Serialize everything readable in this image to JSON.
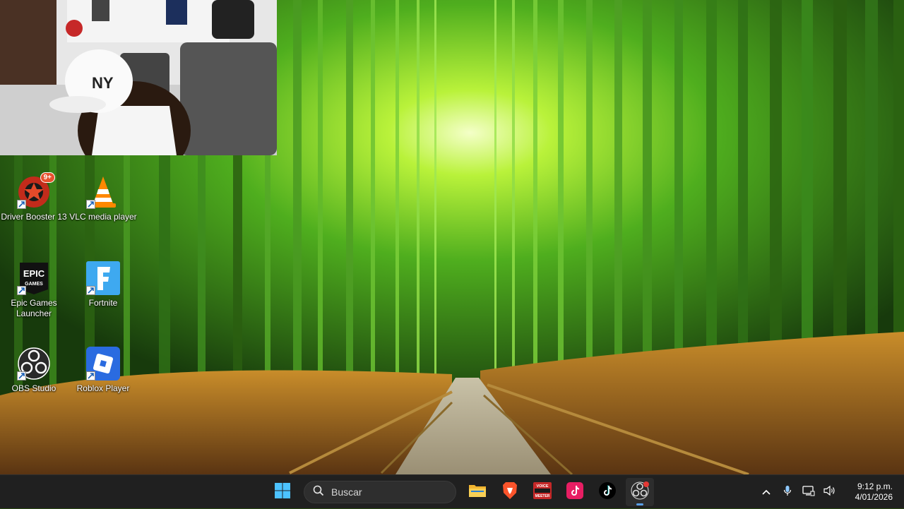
{
  "desktop": {
    "icons": [
      {
        "label": "Driver Booster 13",
        "icon": "driver-booster-icon",
        "badge": "9+"
      },
      {
        "label": "VLC media player",
        "icon": "vlc-icon"
      },
      {
        "label": "Epic Games Launcher",
        "icon": "epic-games-icon",
        "logo_text": "EPIC GAMES"
      },
      {
        "label": "Fortnite",
        "icon": "fortnite-icon",
        "logo_text": "F"
      },
      {
        "label": "OBS Studio",
        "icon": "obs-icon"
      },
      {
        "label": "Roblox Player",
        "icon": "roblox-icon"
      }
    ]
  },
  "webcam": {
    "cap_text": "NY"
  },
  "taskbar": {
    "start_icon": "windows-start-icon",
    "search": {
      "placeholder": "Buscar",
      "value": ""
    },
    "apps": [
      {
        "name": "File Explorer",
        "icon": "folder-icon"
      },
      {
        "name": "Brave",
        "icon": "brave-icon"
      },
      {
        "name": "Voicemeeter",
        "icon": "voicemeeter-icon",
        "logo_text": "VOICE MEETER"
      },
      {
        "name": "TikTok",
        "icon": "tiktok-icon"
      },
      {
        "name": "TikTok",
        "icon": "tiktok-icon"
      },
      {
        "name": "OBS Studio",
        "icon": "obs-icon",
        "active": true
      }
    ],
    "tray": {
      "icons": [
        "chevron-up-icon",
        "microphone-icon",
        "network-icon",
        "speaker-icon"
      ],
      "time": "9:12 p.m.",
      "date": "4/01/2026"
    }
  },
  "colors": {
    "taskbar_bg": "#202020",
    "accent": "#5aa0e8",
    "bamboo": "#4fae1e"
  }
}
